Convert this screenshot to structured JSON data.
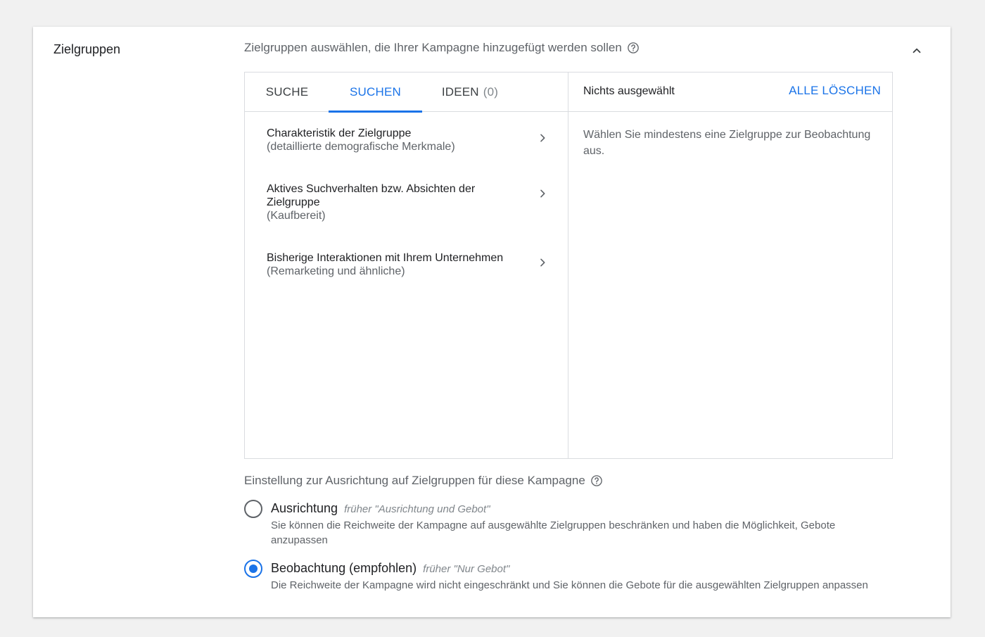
{
  "section": {
    "title": "Zielgruppen",
    "subtitle": "Zielgruppen auswählen, die Ihrer Kampagne hinzugefügt werden sollen"
  },
  "tabs": [
    {
      "label": "SUCHE",
      "count": "",
      "active": false
    },
    {
      "label": "SUCHEN",
      "count": "",
      "active": true
    },
    {
      "label": "IDEEN",
      "count": "(0)",
      "active": false
    }
  ],
  "categories": [
    {
      "title": "Charakteristik der Zielgruppe",
      "desc": "(detaillierte demografische Merkmale)"
    },
    {
      "title": "Aktives Suchverhalten bzw. Absichten der Zielgruppe",
      "desc": "(Kaufbereit)"
    },
    {
      "title": "Bisherige Interaktionen mit Ihrem Unternehmen",
      "desc": "(Remarketing und ähnliche)"
    }
  ],
  "selection": {
    "status": "Nichts ausgewählt",
    "clear_label": "ALLE LÖSCHEN",
    "hint": "Wählen Sie mindestens eine Zielgruppe zur Beobachtung aus."
  },
  "targeting": {
    "label": "Einstellung zur Ausrichtung auf Zielgruppen für diese Kampagne",
    "options": [
      {
        "title": "Ausrichtung",
        "former": "früher \"Ausrichtung und Gebot\"",
        "desc": "Sie können die Reichweite der Kampagne auf ausgewählte Zielgruppen beschränken und haben die Möglichkeit, Gebote anzupassen",
        "checked": false
      },
      {
        "title": "Beobachtung (empfohlen)",
        "former": "früher \"Nur Gebot\"",
        "desc": "Die Reichweite der Kampagne wird nicht eingeschränkt und Sie können die Gebote für die ausgewählten Zielgruppen anpassen",
        "checked": true
      }
    ]
  },
  "colors": {
    "accent": "#1a73e8",
    "text_primary": "#202124",
    "text_secondary": "#5f6368",
    "border": "#dadce0"
  },
  "icons": {
    "collapse": "chevron-up-icon",
    "help": "help-circle-icon",
    "item_arrow": "chevron-right-icon"
  }
}
